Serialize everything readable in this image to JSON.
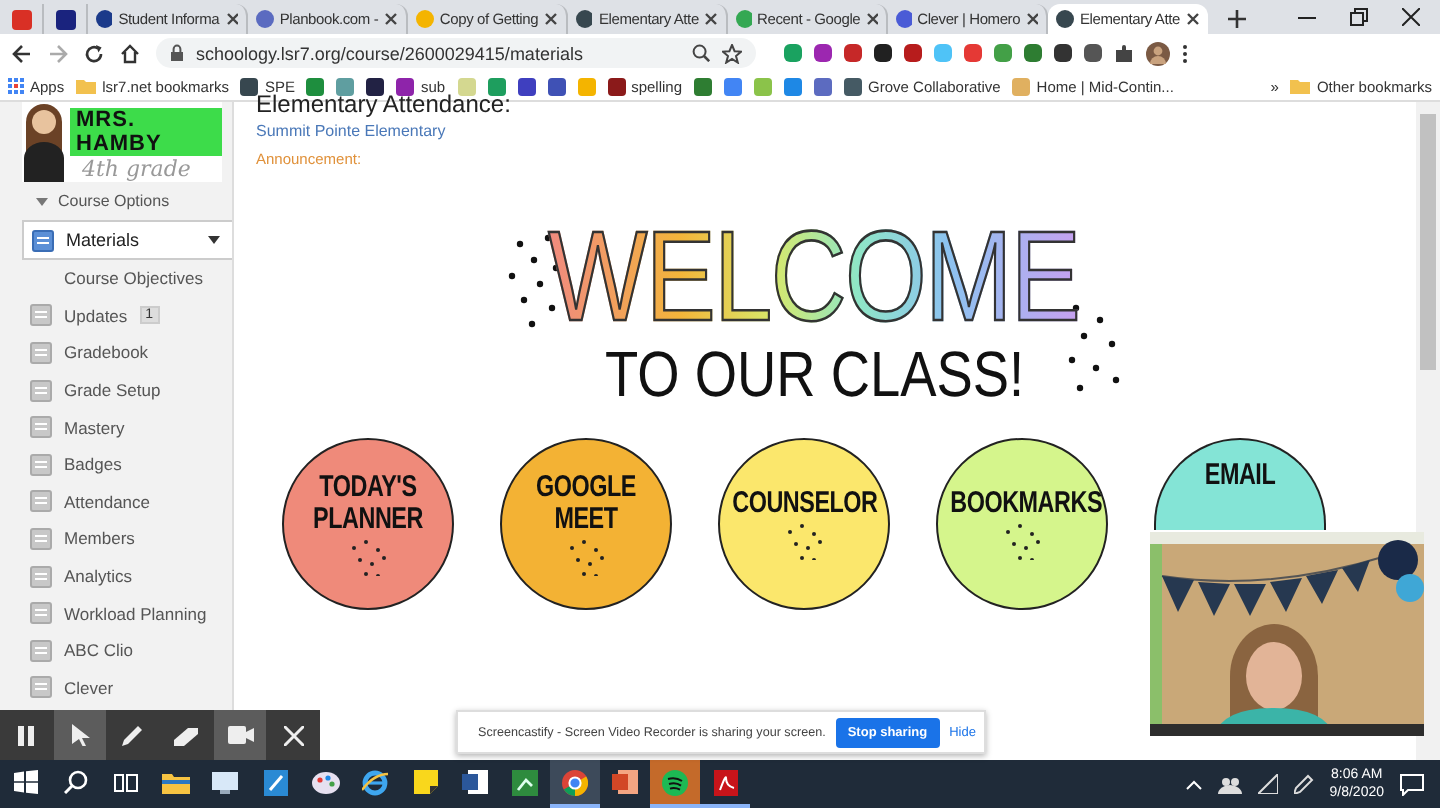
{
  "browser": {
    "pinned_tabs": [
      {
        "color": "#d93025",
        "selected": false
      },
      {
        "color": "#1a237e",
        "selected": false
      }
    ],
    "tabs": [
      {
        "title": "Student Informa",
        "color": "#1b3a8a",
        "selected": false
      },
      {
        "title": "Planbook.com -",
        "color": "#5b6bc0",
        "selected": false
      },
      {
        "title": "Copy of Getting",
        "color": "#f4b400",
        "selected": false
      },
      {
        "title": "Elementary Atte",
        "color": "#37474f",
        "selected": false
      },
      {
        "title": "Recent - Google",
        "color": "#34a853",
        "selected": false
      },
      {
        "title": "Clever | Homero",
        "color": "#4a5bd6",
        "selected": false
      },
      {
        "title": "Elementary Atte",
        "color": "#37474f",
        "selected": true
      }
    ],
    "address": "schoology.lsr7.org/course/2600029415/materials",
    "bookmarks": [
      {
        "kind": "apps",
        "label": "Apps"
      },
      {
        "kind": "folder",
        "label": "lsr7.net bookmarks"
      },
      {
        "kind": "site",
        "label": "SPE",
        "color": "#37474f"
      },
      {
        "kind": "site",
        "color": "#1e8e3e"
      },
      {
        "kind": "site",
        "color": "#5f9ea0"
      },
      {
        "kind": "site",
        "color": "#222244"
      },
      {
        "kind": "site",
        "label": "sub",
        "color": "#8e24aa"
      },
      {
        "kind": "site",
        "color": "#d4d890"
      },
      {
        "kind": "site",
        "color": "#1e9e5e"
      },
      {
        "kind": "site",
        "color": "#3f3fbf"
      },
      {
        "kind": "site",
        "color": "#3f51b5"
      },
      {
        "kind": "site",
        "color": "#f4b400"
      },
      {
        "kind": "site",
        "label": "spelling",
        "color": "#8b1a1a"
      },
      {
        "kind": "site",
        "color": "#2e7d32"
      },
      {
        "kind": "site",
        "color": "#4285f4"
      },
      {
        "kind": "site",
        "color": "#8bc34a"
      },
      {
        "kind": "site",
        "color": "#1e88e5"
      },
      {
        "kind": "site",
        "color": "#5c6bc0"
      },
      {
        "kind": "site",
        "label": "Grove Collaborative",
        "color": "#455a64"
      },
      {
        "kind": "site",
        "label": "Home | Mid-Contin...",
        "color": "#e0b060"
      }
    ],
    "overflow": "»",
    "other_bookmarks": "Other bookmarks"
  },
  "sidebar": {
    "logo": {
      "name": "MRS. HAMBY",
      "subtitle": "4th grade"
    },
    "course_options": "Course Options",
    "items": [
      {
        "label": "Materials",
        "kind": "menu",
        "selected": true
      },
      {
        "label": "Course Objectives",
        "kind": "sub",
        "selected": false
      },
      {
        "label": "Updates",
        "kind": "item",
        "badge": "1",
        "selected": false
      },
      {
        "label": "Gradebook",
        "kind": "item",
        "selected": false
      },
      {
        "label": "Grade Setup",
        "kind": "item",
        "selected": false
      },
      {
        "label": "Mastery",
        "kind": "item",
        "selected": false
      },
      {
        "label": "Badges",
        "kind": "item",
        "selected": false
      },
      {
        "label": "Attendance",
        "kind": "item",
        "selected": false
      },
      {
        "label": "Members",
        "kind": "item",
        "selected": false
      },
      {
        "label": "Analytics",
        "kind": "item",
        "selected": false
      },
      {
        "label": "Workload Planning",
        "kind": "item",
        "selected": false
      },
      {
        "label": "ABC Clio",
        "kind": "item",
        "selected": false
      },
      {
        "label": "Clever",
        "kind": "item",
        "selected": false
      }
    ]
  },
  "main": {
    "title": "Elementary Attendance:",
    "school": "Summit Pointe Elementary",
    "announcement": "Announcement:",
    "welcome": {
      "title": "WELCOME",
      "subtitle": "TO OUR CLASS!"
    },
    "links": [
      {
        "label": "TODAY'S PLANNER",
        "color": "#ef8a7a",
        "partly_covered": false
      },
      {
        "label": "GOOGLE MEET",
        "color": "#f3b234",
        "partly_covered": false
      },
      {
        "label": "COUNSELOR",
        "color": "#fbe76c",
        "partly_covered": false
      },
      {
        "label": "BOOKMARKS",
        "color": "#d5f58c",
        "partly_covered": false
      },
      {
        "label": "EMAIL",
        "color": "#84e4d6",
        "partly_covered": true
      }
    ]
  },
  "recorder": {
    "toolbar": [
      {
        "kind": "pause",
        "selected": false
      },
      {
        "kind": "cursor",
        "selected": true
      },
      {
        "kind": "pen",
        "selected": false
      },
      {
        "kind": "eraser",
        "selected": false
      },
      {
        "kind": "camera",
        "selected": true
      },
      {
        "kind": "close",
        "selected": false
      }
    ],
    "share_bar": {
      "message": "Screencastify - Screen Video Recorder is sharing your screen.",
      "stop": "Stop sharing",
      "hide": "Hide"
    }
  },
  "taskbar": {
    "apps": [
      {
        "kind": "start",
        "running": false,
        "selected": false
      },
      {
        "kind": "search",
        "running": false,
        "selected": false
      },
      {
        "kind": "task-view",
        "running": false,
        "selected": false
      },
      {
        "kind": "explorer",
        "running": false,
        "selected": false
      },
      {
        "kind": "monitor",
        "running": false,
        "selected": false
      },
      {
        "kind": "notes",
        "running": false,
        "selected": false
      },
      {
        "kind": "paint",
        "running": false,
        "selected": false
      },
      {
        "kind": "ie",
        "running": false,
        "selected": false
      },
      {
        "kind": "sticky",
        "running": false,
        "selected": false
      },
      {
        "kind": "word",
        "running": false,
        "selected": false
      },
      {
        "kind": "sheet",
        "running": false,
        "selected": false
      },
      {
        "kind": "chrome",
        "running": true,
        "selected": true
      },
      {
        "kind": "powerpoint",
        "running": false,
        "selected": false
      },
      {
        "kind": "spotify",
        "running": true,
        "selected": false,
        "attention": true
      },
      {
        "kind": "acrobat",
        "running": true,
        "selected": false
      }
    ],
    "time": "8:06 AM",
    "date": "9/8/2020"
  }
}
